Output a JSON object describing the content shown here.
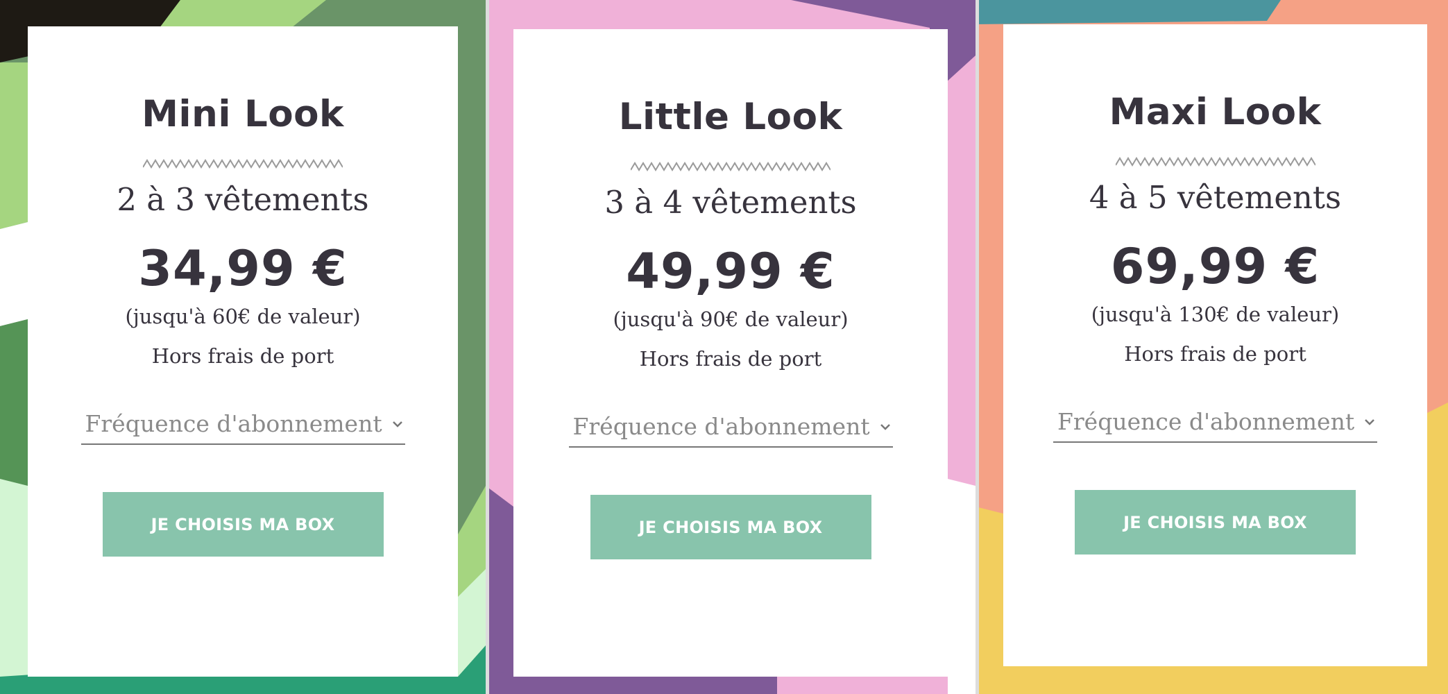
{
  "plans": [
    {
      "title": "Mini Look",
      "items": "2 à 3 vêtements",
      "price": "34,99 €",
      "value_note": "(jusqu'à 60€ de valeur)",
      "shipping_note": "Hors frais de port",
      "frequency_placeholder": "Fréquence d'abonnement",
      "cta_label": "JE CHOISIS MA BOX"
    },
    {
      "title": "Little Look",
      "items": "3 à 4 vêtements",
      "price": "49,99 €",
      "value_note": "(jusqu'à 90€ de valeur)",
      "shipping_note": "Hors frais de port",
      "frequency_placeholder": "Fréquence d'abonnement",
      "cta_label": "JE CHOISIS MA BOX"
    },
    {
      "title": "Maxi Look",
      "items": "4 à 5 vêtements",
      "price": "69,99 €",
      "value_note": "(jusqu'à 130€ de valeur)",
      "shipping_note": "Hors frais de port",
      "frequency_placeholder": "Fréquence d'abonnement",
      "cta_label": "JE CHOISIS MA BOX"
    }
  ],
  "icons": {
    "divider": "zigzag-divider-icon",
    "dropdown": "chevron-down-icon"
  },
  "colors": {
    "text": "#37333d",
    "button": "#88c4ac",
    "placeholder": "#8a8a8a",
    "panel_green": [
      "#1e1a14",
      "#a5d580",
      "#6a9468",
      "#d3f5d3",
      "#2a9f76"
    ],
    "panel_pink_purple": [
      "#f0b1d8",
      "#7f5a98"
    ],
    "panel_coral_yellow": [
      "#f5a185",
      "#4b959e",
      "#f2ce5e"
    ]
  }
}
